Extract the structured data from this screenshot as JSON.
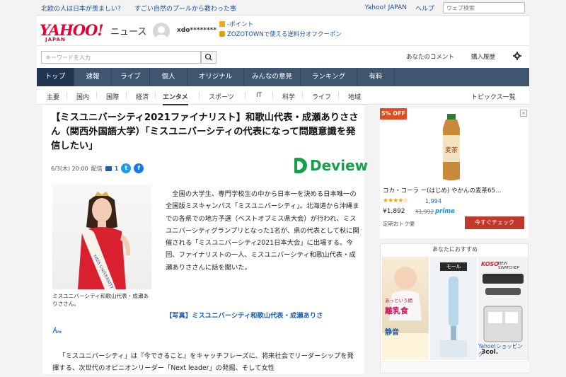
{
  "topbar": {
    "link1": "北欧の人は日本が羨ましい？",
    "link2": "すごい自然のプールから教わった事",
    "yahoo_japan": "Yahoo! JAPAN",
    "help": "ヘルプ",
    "web_search_placeholder": "ウェブ検索"
  },
  "header": {
    "logo": "YAHOO!",
    "logo_sub": "JAPAN",
    "service": "ニュース",
    "username": "xdo********",
    "points": "-ポイント",
    "zozo": "ZOZOTOWNで使える送料分オフクーポン"
  },
  "search": {
    "placeholder": "キーワードを入力",
    "your_comments": "あなたのコメント",
    "history": "購入履歴"
  },
  "mainnav": [
    "トップ",
    "速報",
    "ライブ",
    "個人",
    "オリジナル",
    "みんなの意見",
    "ランキング",
    "有料"
  ],
  "subnav": [
    "主要",
    "国内",
    "国際",
    "経済",
    "エンタメ",
    "スポーツ",
    "IT",
    "科学",
    "ライフ",
    "地域"
  ],
  "subnav_right": "トピックス一覧",
  "article": {
    "title": "【ミスユニバーシティ2021ファイナリスト】和歌山代表・成瀬ありささん（関西外国語大学）「ミスユニバーシティの代表になって問題意識を発信したい」",
    "date": "6/3(木) 20:00",
    "distributed": "配信",
    "comments": "1",
    "source": "Deview",
    "sash_text": "MISS UNIVERSITY WAKAYAMA",
    "caption": "ミスユニバーシティ和歌山代表・成瀬ありささん。",
    "paragraph1": "全国の大学生、専門学校生の中から日本一を決める日本唯一の全国版ミスキャンパス「ミスユニバーシティ」。北海道から沖縄までの各県での地方予選（ベストオブミス県大会）が行われ、ミスユニバーシティグランプリとなった1名が、県の代表として秋に開催される「ミスユニバーシティ2021日本大会」に出場する。今回、ファイナリストの一人、ミスユニバーシティ和歌山代表・成瀬ありささんに話を聞いた。",
    "photo_link": "【写真】ミスユニバーシティ和歌山代表・成瀬ありさ",
    "photo_link_tail": "ん。",
    "paragraph2": "「ミスユニバーシティ」は『今できること』をキャッチフレーズに、将来社会でリーダーシップを発揮する、次世代のオピニオンリーダー「Next leader」の発掘、そして女性"
  },
  "ad1": {
    "badge": "5% OFF",
    "close": "×",
    "bottle_text": "麦茶",
    "product": "コカ・コーラ ー(はじめ) やかんの麦茶65…",
    "stars": "★★★★☆",
    "rating_count": "1,994",
    "price": "¥1,892",
    "old_price": "¥1,992",
    "prime": "prime",
    "deal": "定期おトク便",
    "cta": "今すぐチェック"
  },
  "ad2": {
    "heading": "あなたにおすすめ",
    "moll": "モール",
    "small": "あっという間",
    "rikyu": "離乳食",
    "quiet": "静音",
    "koso": "KOSO",
    "koso_sub": "NEW SWATCHEP",
    "three": "3col.",
    "shop": "Yahoo!ショッピング"
  },
  "colors": {
    "nav_bg": "#3f5670",
    "nav_active": "#1f3550",
    "link": "#1a5fb4",
    "logo": "#e60033",
    "deview": "#16a04a"
  }
}
